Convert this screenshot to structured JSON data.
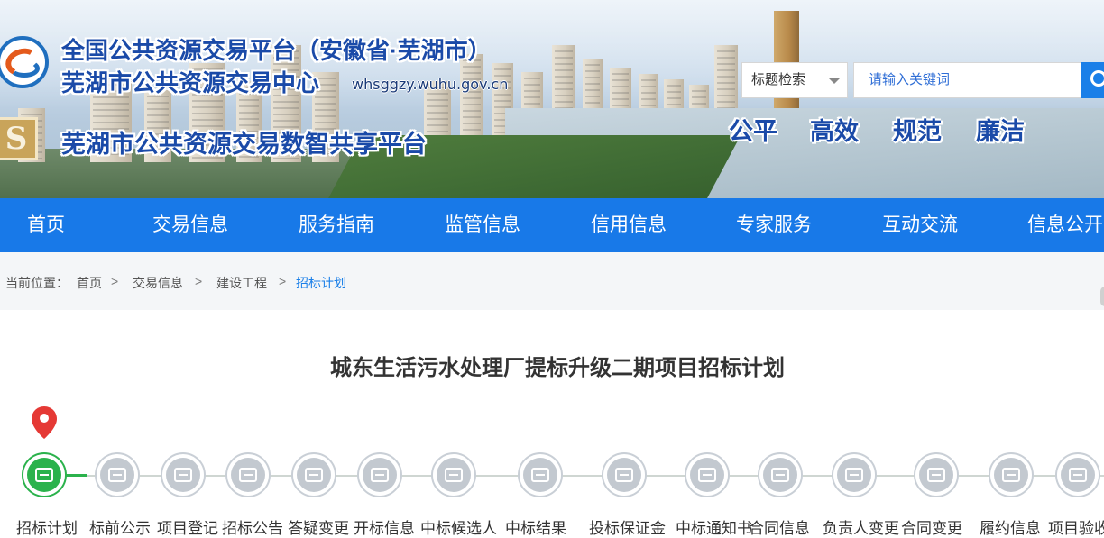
{
  "header": {
    "title_line1": "全国公共资源交易平台（安徽省·芜湖市）",
    "title_line2": "芜湖市公共资源交易中心",
    "domain": "whsggzy.wuhu.gov.cn",
    "title_line3": "芜湖市公共资源交易数智共享平台",
    "slogans": [
      "公平",
      "高效",
      "规范",
      "廉洁"
    ]
  },
  "search": {
    "mode_label": "标题检索",
    "placeholder": "请输入关键词"
  },
  "nav": {
    "items": [
      "首页",
      "交易信息",
      "服务指南",
      "监管信息",
      "信用信息",
      "专家服务",
      "互动交流",
      "信息公开"
    ]
  },
  "breadcrumb": {
    "prefix": "当前位置：",
    "items": [
      "首页",
      "交易信息",
      "建设工程",
      "招标计划"
    ],
    "separator": ">"
  },
  "page": {
    "title": "城东生活污水处理厂提标升级二期项目招标计划"
  },
  "steps": {
    "active_index": 0,
    "labels": [
      "招标计划",
      "标前公示",
      "项目登记",
      "招标公告",
      "答疑变更",
      "开标信息",
      "中标候选人",
      "中标结果",
      "投标保证金",
      "中标通知书",
      "合同信息",
      "负责人变更",
      "合同变更",
      "履约信息",
      "项目验收"
    ],
    "icons": [
      "box-icon",
      "doc-edit-icon",
      "doc-edit-icon",
      "doc-edit-icon",
      "box-icon",
      "checklist-icon",
      "target-icon",
      "certificate-icon",
      "receipt-icon",
      "folder-icon",
      "folder-icon",
      "folder-icon",
      "folder-icon",
      "folder-icon",
      "folder-icon"
    ]
  },
  "colors": {
    "brand_blue": "#1879e8",
    "title_blue": "#1a4aa8",
    "active_green": "#2bb24c",
    "inactive_gray": "#c3c9d0"
  }
}
